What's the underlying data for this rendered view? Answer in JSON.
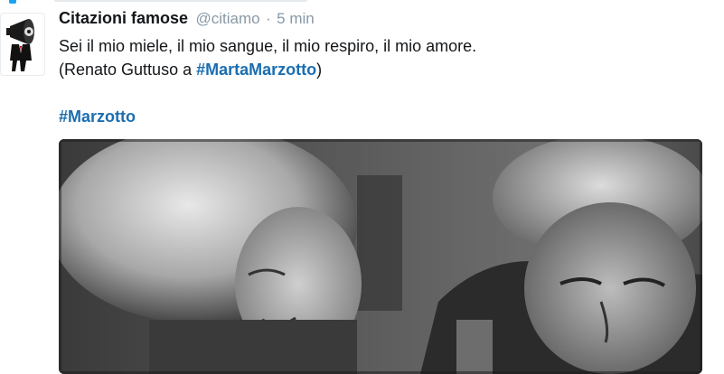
{
  "tweet": {
    "author": {
      "display_name": "Citazioni famose",
      "handle": "@citiamo"
    },
    "separator": "·",
    "timestamp": "5 min",
    "text": {
      "line1": "Sei il mio miele, il mio sangue, il mio respiro, il mio amore.",
      "line2_prefix": "(Renato Guttuso a ",
      "line2_hashtag": "#MartaMarzotto",
      "line2_suffix": ")",
      "hashtag2": "#Marzotto"
    },
    "media": {
      "kind": "black-and-white photo",
      "icon": "photo-icon"
    },
    "colors": {
      "hashtag": "#1b6eb1",
      "name": "#14171a",
      "meta": "#8899a6",
      "accent": "#1da1f2"
    }
  }
}
